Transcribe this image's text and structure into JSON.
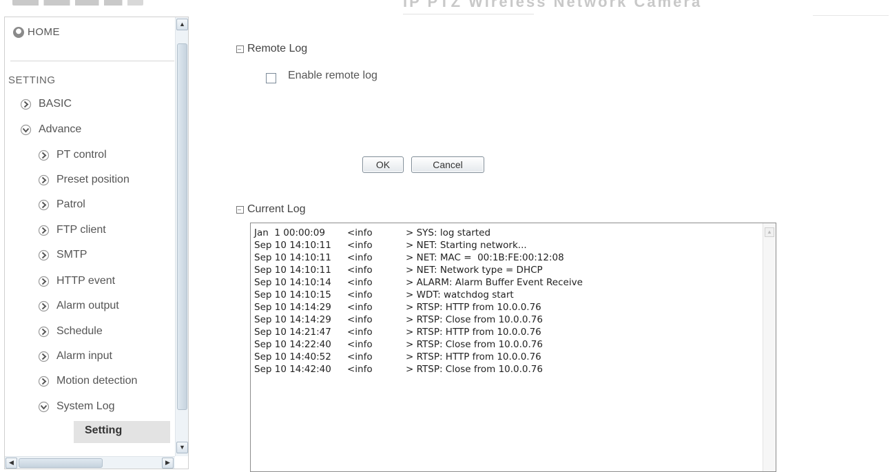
{
  "header": {
    "title": "IP PTZ Wireless Network Camera"
  },
  "sidebar": {
    "home_label": "HOME",
    "setting_label": "SETTING",
    "items": [
      {
        "label": "BASIC",
        "expanded": false
      },
      {
        "label": "Advance",
        "expanded": true
      },
      {
        "label": "PT control",
        "expanded": false
      },
      {
        "label": "Preset position",
        "expanded": false
      },
      {
        "label": "Patrol",
        "expanded": false
      },
      {
        "label": "FTP client",
        "expanded": false
      },
      {
        "label": "SMTP",
        "expanded": false
      },
      {
        "label": "HTTP event",
        "expanded": false
      },
      {
        "label": "Alarm output",
        "expanded": false
      },
      {
        "label": "Schedule",
        "expanded": false
      },
      {
        "label": "Alarm input",
        "expanded": false
      },
      {
        "label": "Motion detection",
        "expanded": false
      },
      {
        "label": "System Log",
        "expanded": true
      }
    ],
    "active_sub_item": "Setting"
  },
  "remote_log": {
    "title": "Remote Log",
    "enable_label": "Enable remote log",
    "enabled": false
  },
  "buttons": {
    "ok": "OK",
    "cancel": "Cancel"
  },
  "current_log": {
    "title": "Current Log",
    "entries": [
      {
        "time": "Jan  1 00:00:09",
        "level": "<info",
        "message": "> SYS: log started"
      },
      {
        "time": "Sep 10 14:10:11",
        "level": "<info",
        "message": "> NET: Starting network..."
      },
      {
        "time": "Sep 10 14:10:11",
        "level": "<info",
        "message": "> NET: MAC =  00:1B:FE:00:12:08"
      },
      {
        "time": "Sep 10 14:10:11",
        "level": "<info",
        "message": "> NET: Network type = DHCP"
      },
      {
        "time": "Sep 10 14:10:14",
        "level": "<info",
        "message": "> ALARM: Alarm Buffer Event Receive"
      },
      {
        "time": "Sep 10 14:10:15",
        "level": "<info",
        "message": "> WDT: watchdog start"
      },
      {
        "time": "Sep 10 14:14:29",
        "level": "<info",
        "message": "> RTSP: HTTP from 10.0.0.76"
      },
      {
        "time": "Sep 10 14:14:29",
        "level": "<info",
        "message": "> RTSP: Close from 10.0.0.76"
      },
      {
        "time": "Sep 10 14:21:47",
        "level": "<info",
        "message": "> RTSP: HTTP from 10.0.0.76"
      },
      {
        "time": "Sep 10 14:22:40",
        "level": "<info",
        "message": "> RTSP: Close from 10.0.0.76"
      },
      {
        "time": "Sep 10 14:40:52",
        "level": "<info",
        "message": "> RTSP: HTTP from 10.0.0.76"
      },
      {
        "time": "Sep 10 14:42:40",
        "level": "<info",
        "message": "> RTSP: Close from 10.0.0.76"
      }
    ]
  },
  "icons": {
    "home": "home-icon",
    "nav_collapsed": "arrow-right-icon",
    "nav_expanded": "arrow-down-icon",
    "section": "square-icon"
  }
}
